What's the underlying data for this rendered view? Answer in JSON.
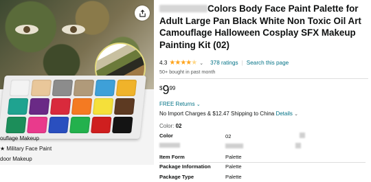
{
  "product": {
    "title_prefix_redacted": true,
    "title": "Colors Body Face Paint Palette for Adult Large Pan Black White Non Toxic Oil Art Camouflage Halloween Cosplay SFX Makeup Painting Kit (02)",
    "rating_value": "4.3",
    "ratings_count": "378 ratings",
    "search_link": "Search this page",
    "bought_text": "50+ bought in past month",
    "price": {
      "symbol": "$",
      "whole": "9",
      "fraction": "99"
    },
    "returns_text": "FREE Returns",
    "shipping_text": "No Import Charges & $12.47 Shipping to China",
    "shipping_details_link": "Details",
    "color_label": "Color:",
    "color_value": "02",
    "specs": [
      {
        "key": "Color",
        "value": "02"
      },
      {
        "key": "",
        "value": ""
      },
      {
        "key": "Item Form",
        "value": "Palette"
      },
      {
        "key": "Package Information",
        "value": "Palette"
      },
      {
        "key": "Package Type",
        "value": "Palette"
      }
    ]
  },
  "image": {
    "captions": [
      "ouflage Makeup",
      "Military Face Paint",
      "door Makeup"
    ],
    "pan_colors": [
      "#f3f3f3",
      "#e9c79a",
      "#8c8c8c",
      "#b09a7a",
      "#3ea0d8",
      "#f0b32a",
      "#1fa390",
      "#6a2a86",
      "#d92a3c",
      "#f47a22",
      "#f5e03a",
      "#5d3a22",
      "#1c8e5a",
      "#e93a8c",
      "#2a4fbf",
      "#23b14d",
      "#cf1f1f",
      "#141414"
    ]
  }
}
